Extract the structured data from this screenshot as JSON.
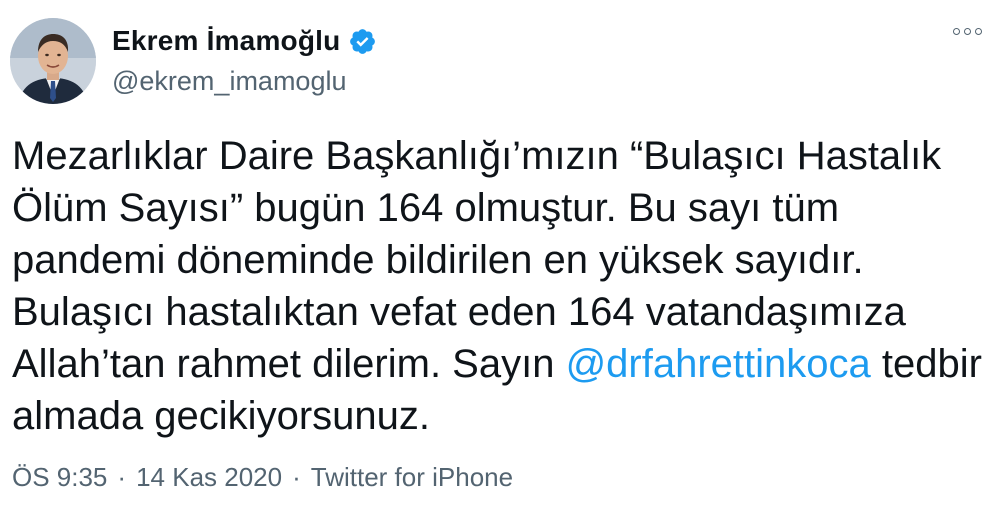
{
  "author": {
    "name": "Ekrem İmamoğlu",
    "handle": "@ekrem_imamoglu",
    "verified": true
  },
  "tweet": {
    "text_before": "Mezarlıklar Daire Başkanlığı’mızın “Bulaşıcı Hastalık Ölüm Sayısı” bugün 164 olmuştur. Bu sayı tüm pandemi döneminde bildirilen en yüksek sayıdır. Bulaşıcı hastalıktan vefat eden 164 vatandaşımıza Allah’tan rahmet dilerim. Sayın ",
    "mention": "@drfahrettinkoca",
    "text_after": " tedbir almada gecikiyorsunuz."
  },
  "meta": {
    "time": "ÖS 9:35",
    "separator": "·",
    "date": "14 Kas 2020",
    "source": "Twitter for iPhone"
  },
  "colors": {
    "accent": "#1d9bf0",
    "text": "#0f1419",
    "muted": "#536471"
  },
  "icons": [
    "verified-badge-icon",
    "more-options-icon"
  ]
}
